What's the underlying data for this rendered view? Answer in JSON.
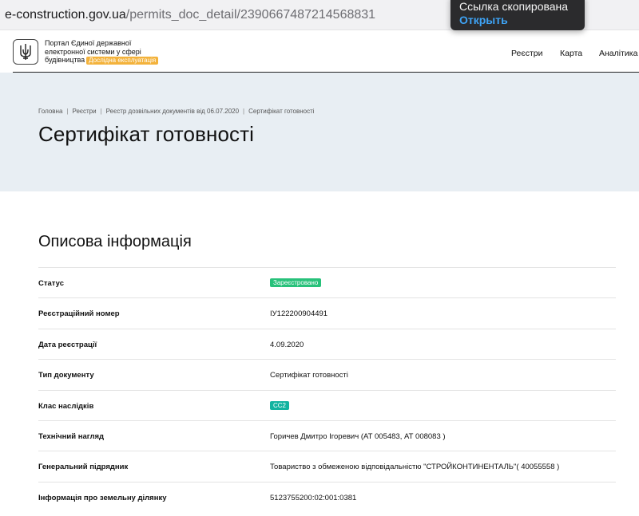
{
  "browser": {
    "url_host": "e-construction.gov.ua",
    "url_path": "/permits_doc_detail/2390667487214568831"
  },
  "toast": {
    "message": "Ссылка скопирована",
    "action": "Открыть"
  },
  "header": {
    "portal_name_line1": "Портал Єдиної державної",
    "portal_name_line2": "електронної системи у сфері",
    "portal_name_line3": "будівництва",
    "beta_badge": "Дослідна експлуатація",
    "nav": [
      "Реєстри",
      "Карта",
      "Аналітика"
    ]
  },
  "breadcrumb": [
    "Головна",
    "Реєстри",
    "Реєстр дозвільних документів від 06.07.2020",
    "Сертифікат готовності"
  ],
  "page_title": "Сертифікат готовності",
  "section_title": "Описова інформація",
  "rows": [
    {
      "label": "Статус",
      "value": "Зареєстровано",
      "kind": "badge",
      "color": "#27c17a"
    },
    {
      "label": "Реєстраційний номер",
      "value": "IУ122200904491",
      "kind": "text"
    },
    {
      "label": "Дата реєстрації",
      "value": "4.09.2020",
      "kind": "text"
    },
    {
      "label": "Тип документу",
      "value": "Сертифікат готовності",
      "kind": "text"
    },
    {
      "label": "Клас наслідків",
      "value": "СС2",
      "kind": "badge",
      "color": "#12b3a0"
    },
    {
      "label": "Технічний нагляд",
      "value": "Горичев Дмитро Ігоревич (АТ 005483, АТ 008083 )",
      "kind": "text"
    },
    {
      "label": "Генеральний підрядник",
      "value": "Товариство з обмеженою відповідальністю \"СТРОЙКОНТИНЕНТАЛЬ\"( 40055558 )",
      "kind": "text"
    },
    {
      "label": "Інформація про земельну ділянку",
      "value": "5123755200:02:001:0381",
      "kind": "text"
    }
  ],
  "colors": {
    "hero_bg": "#e8eef3",
    "beta_badge": "#f3b23b",
    "toast_action": "#3ea3f5"
  }
}
